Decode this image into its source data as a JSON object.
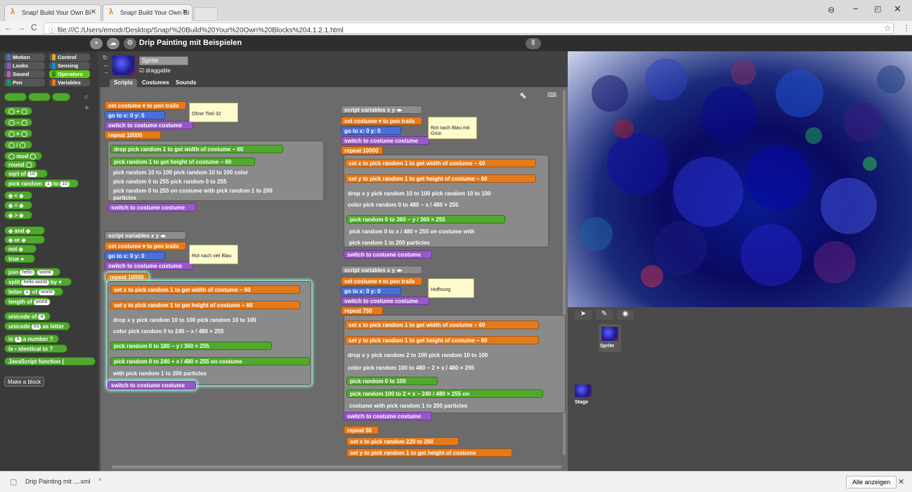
{
  "browser": {
    "tabs": [
      {
        "label": "Snap! Build Your Own Bl"
      },
      {
        "label": "Snap! Build Your Own Bl"
      }
    ],
    "url": "file:///C:/Users/emodr/Desktop/Snap!%20Build%20Your%20Own%20Blocks%204.1.2.1.html"
  },
  "snap": {
    "project_title": "Drip Painting mit Beispielen",
    "categories": [
      "Motion",
      "Looks",
      "Sound",
      "Pen",
      "Control",
      "Sensing",
      "Operators",
      "Variables"
    ],
    "category_colors": {
      "Motion": "#4a6fd8",
      "Looks": "#8f56e3",
      "Sound": "#cf4ad9",
      "Pen": "#00a178",
      "Control": "#e6a822",
      "Sensing": "#0494dc",
      "Operators": "#62c213",
      "Variables": "#f3761d"
    },
    "palette_blocks": [
      {
        "text": "mod"
      },
      {
        "text": "round"
      },
      {
        "text": "sqrt",
        "slot": "10",
        "label": "of"
      },
      {
        "text": "pick random",
        "slot": "1",
        "label": "to",
        "slot2": "10"
      },
      {
        "text": "and"
      },
      {
        "text": "or"
      },
      {
        "text": "not"
      },
      {
        "text": "true"
      },
      {
        "text": "join",
        "slot": "hello",
        "slot2": "world"
      },
      {
        "text": "split",
        "slot": "hello world",
        "label": "by"
      },
      {
        "text": "letter",
        "slot": "1",
        "label": "of",
        "slot2": "world"
      },
      {
        "text": "length of",
        "slot": "world"
      },
      {
        "text": "unicode of",
        "slot": "a"
      },
      {
        "text": "unicode",
        "slot": "65",
        "label": "as letter"
      },
      {
        "text": "is",
        "slot": "5",
        "label": "a number ?"
      },
      {
        "text": "is",
        "label": "identical to",
        "slot": "?"
      },
      {
        "text": "JavaScript function ("
      }
    ],
    "make_block_label": "Make a block",
    "sprite_name": "Sprite",
    "draggable_label": "draggable",
    "tabs": [
      "Scripts",
      "Costumes",
      "Sounds"
    ],
    "notes": [
      "Ohne Titel 32",
      "Rot nach Blau mit Grün",
      "Rot nach viel Blau",
      "Hoffnung"
    ],
    "script1": {
      "lines": [
        "set costume ▾ to pen trails",
        "go to x: 0 y: 0",
        "switch to costume costume",
        "repeat 10000",
        "drop pick random 1 to get width of costume − 60",
        "pick random 1 to get height of costume − 60",
        "pick random 10 to 100   pick random 10 to 100   color",
        "pick random 0 to 255   pick random 0 to 255",
        "pick random 0 to 255   on costume with pick random 1 to 200",
        "particles",
        "switch to costume costume"
      ]
    },
    "script2": {
      "lines": [
        "script variables x y ◂▸",
        "set costume ▾ to pen trails",
        "go to x: 0 y: 0",
        "switch to costume costume",
        "repeat 10000",
        "set x to pick random 1 to get width of costume − 60",
        "set y to pick random 1 to get height of costume − 60",
        "drop x y pick random 10 to 100   pick random 10 to 100",
        "color pick random 0 to 240 − x / 480 × 255",
        "pick random 0 to 180 − y / 360 × 255",
        "pick random 0 to 240 + x / 480 × 255   on costume",
        "with pick random 1 to 200 particles",
        "switch to costume costume"
      ]
    },
    "script3": {
      "lines": [
        "script variables x y ◂▸",
        "set costume ▾ to pen trails",
        "go to x: 0 y: 0",
        "switch to costume costume",
        "repeat 10000",
        "set x to pick random 1 to get width of costume − 60",
        "set y to pick random 1 to get height of costume − 60",
        "drop x y pick random 10 to 100   pick random 10 to 100",
        "color pick random 0 to 480 − x / 480 × 255",
        "pick random 0 to 360 − y / 360 × 255",
        "pick random 0 to x / 480 × 255   on costume with",
        "pick random 1 to 200 particles",
        "switch to costume costume"
      ]
    },
    "script4": {
      "lines": [
        "script variables x y ◂▸",
        "set costume ▾ to pen trails",
        "go to x: 0 y: 0",
        "switch to costume costume",
        "repeat 750",
        "set x to pick random 1 to get width of costume − 60",
        "set y to pick random 1 to get height of costume − 60",
        "drop x y pick random 2 to 100   pick random 10 to 100",
        "color pick random 100 to 480 − 2 × x / 480 × 255",
        "pick random 0 to 100",
        "pick random 100 to 2 × x − 240 / 480 × 255   on",
        "costume with pick random 1 to 200 particles",
        "switch to costume costume",
        "repeat 50",
        "set x to pick random 220 to 260",
        "set y to pick random 1 to get height of costume"
      ]
    },
    "corral": {
      "sprite_label": "Sprite",
      "stage_label": "Stage"
    }
  },
  "downloads": {
    "file_label": "Drip Painting mit ....xml",
    "show_all": "Alle anzeigen"
  }
}
